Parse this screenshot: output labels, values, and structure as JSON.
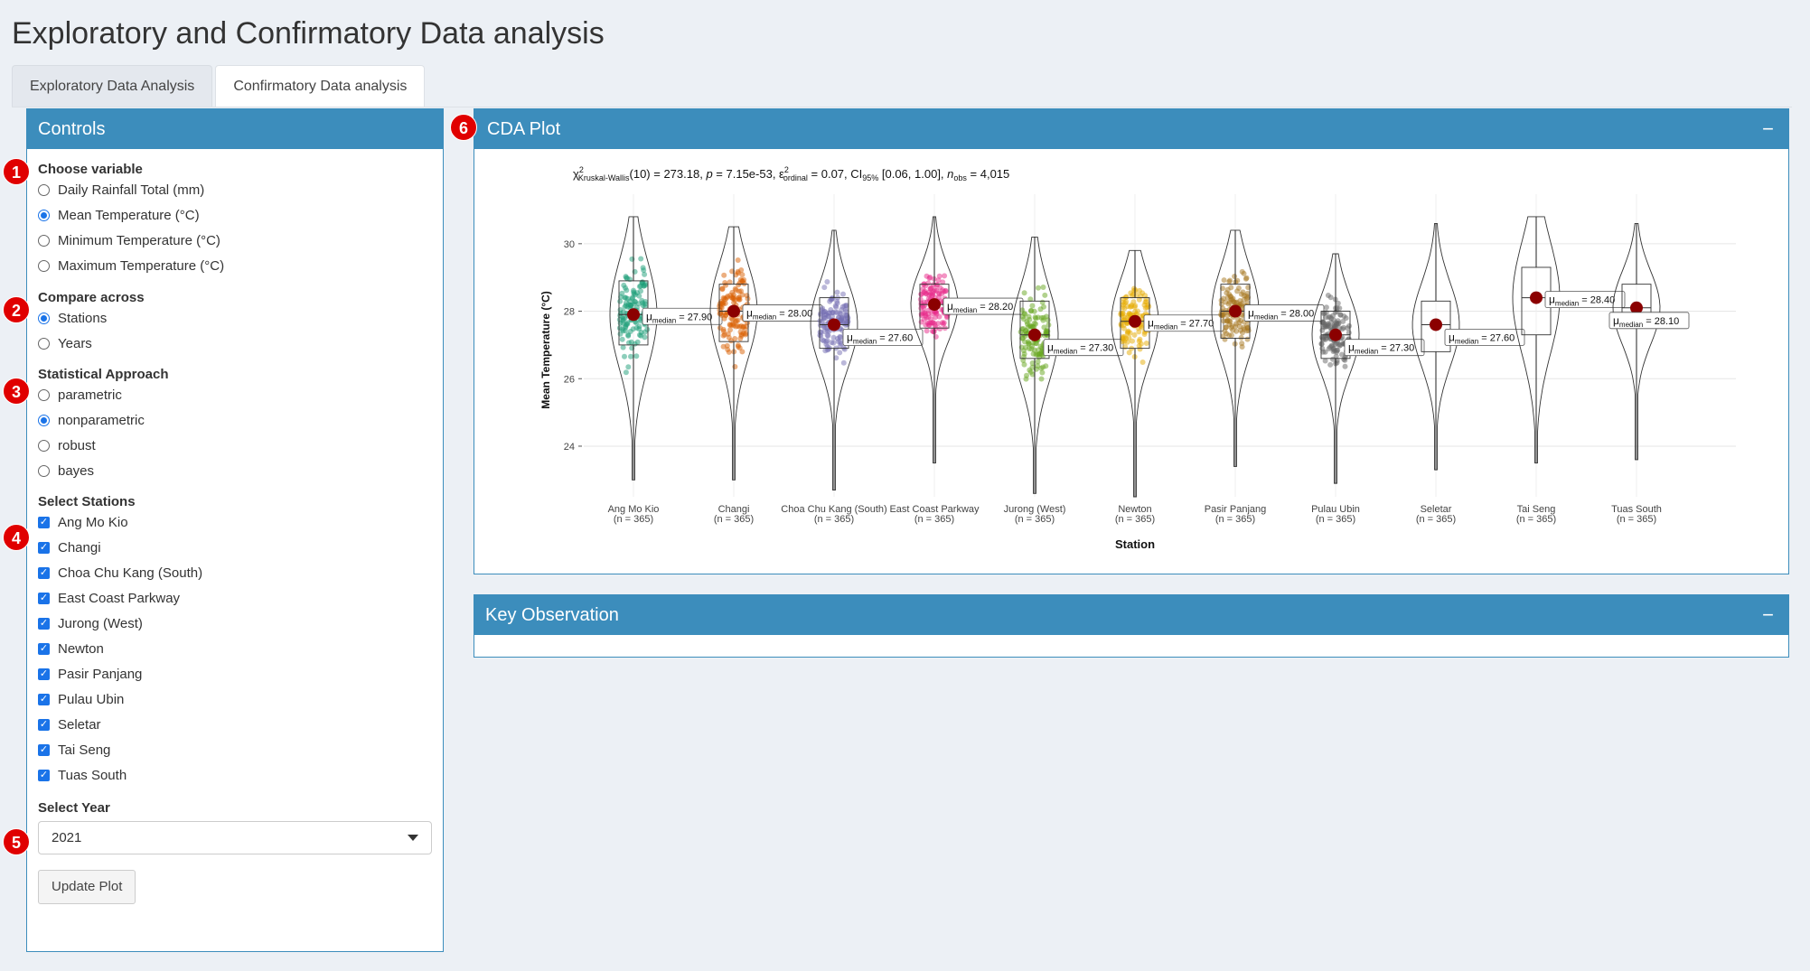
{
  "app": {
    "title": "Exploratory and Confirmatory Data analysis"
  },
  "tabs": [
    {
      "label": "Exploratory Data Analysis",
      "active": false
    },
    {
      "label": "Confirmatory Data analysis",
      "active": true
    }
  ],
  "controls": {
    "title": "Controls",
    "variable": {
      "label": "Choose variable",
      "options": [
        "Daily Rainfall Total (mm)",
        "Mean Temperature (°C)",
        "Minimum Temperature (°C)",
        "Maximum Temperature (°C)"
      ],
      "selected": "Mean Temperature (°C)"
    },
    "compare": {
      "label": "Compare across",
      "options": [
        "Stations",
        "Years"
      ],
      "selected": "Stations"
    },
    "approach": {
      "label": "Statistical Approach",
      "options": [
        "parametric",
        "nonparametric",
        "robust",
        "bayes"
      ],
      "selected": "nonparametric"
    },
    "stations": {
      "label": "Select Stations",
      "options": [
        "Ang Mo Kio",
        "Changi",
        "Choa Chu Kang (South)",
        "East Coast Parkway",
        "Jurong (West)",
        "Newton",
        "Pasir Panjang",
        "Pulau Ubin",
        "Seletar",
        "Tai Seng",
        "Tuas South"
      ],
      "checked": [
        true,
        true,
        true,
        true,
        true,
        true,
        true,
        true,
        true,
        true,
        true
      ]
    },
    "year": {
      "label": "Select Year",
      "value": "2021"
    },
    "update_button": "Update Plot"
  },
  "badges": [
    "1",
    "2",
    "3",
    "4",
    "5",
    "6"
  ],
  "cda_box": {
    "title": "CDA Plot",
    "collapse": "−"
  },
  "key_box": {
    "title": "Key Observation",
    "collapse": "−"
  },
  "chart_data": {
    "type": "violin-box",
    "subtitle": {
      "stat_symbol": "χ",
      "stat_sup": "2",
      "stat_sub": "Kruskal-Wallis",
      "stat_value": "(10) = 273.18,",
      "p_label": "p",
      "p_value": "= 7.15e-53,",
      "effect_symbol": "ε",
      "effect_sup": "2",
      "effect_sub": "ordinal",
      "effect_value": "= 0.07, CI",
      "ci_sub": "95%",
      "ci_value": "[0.06, 1.00],",
      "n_label": "n",
      "n_sub": "obs",
      "n_value": "= 4,015"
    },
    "xlabel": "Station",
    "ylabel": "Mean Temperature (°C)",
    "ylim": [
      22.5,
      31.2
    ],
    "yticks": [
      24,
      26,
      28,
      30
    ],
    "median_prefix": "μ",
    "median_sub": "median",
    "categories": [
      "Ang Mo Kio",
      "Changi",
      "Choa Chu Kang (South)",
      "East Coast Parkway",
      "Jurong (West)",
      "Newton",
      "Pasir Panjang",
      "Pulau Ubin",
      "Seletar",
      "Tai Seng",
      "Tuas South"
    ],
    "n_labels": [
      "(n = 365)",
      "(n = 365)",
      "(n = 365)",
      "(n = 365)",
      "(n = 365)",
      "(n = 365)",
      "(n = 365)",
      "(n = 365)",
      "(n = 365)",
      "(n = 365)",
      "(n = 365)"
    ],
    "medians": [
      27.9,
      28.0,
      27.6,
      28.2,
      27.3,
      27.7,
      28.0,
      27.3,
      27.6,
      28.4,
      28.1
    ],
    "median_labels": [
      "= 27.90",
      "= 28.00",
      "= 27.60",
      "= 28.20",
      "= 27.30",
      "= 27.70",
      "= 28.00",
      "= 27.30",
      "= 27.60",
      "= 28.40",
      "= 28.10"
    ],
    "q1": [
      27.0,
      27.1,
      26.9,
      27.5,
      26.6,
      26.9,
      27.2,
      26.6,
      26.8,
      27.3,
      27.5
    ],
    "q3": [
      28.9,
      28.8,
      28.4,
      28.8,
      28.3,
      28.4,
      28.8,
      28.0,
      28.3,
      29.3,
      28.8
    ],
    "min": [
      23.0,
      23.0,
      22.7,
      23.5,
      22.6,
      22.5,
      23.4,
      22.9,
      23.3,
      23.5,
      23.6
    ],
    "max": [
      30.8,
      30.5,
      30.4,
      30.8,
      30.2,
      29.8,
      30.4,
      29.7,
      30.6,
      30.8,
      30.6
    ],
    "colors": [
      "#1b9e77",
      "#d95f02",
      "#7570b3",
      "#e7298a",
      "#66a61e",
      "#e6ab02",
      "#a6761d",
      "#666666",
      "#e41a1c",
      "#377eb8",
      "#4daf4a"
    ],
    "has_points": [
      true,
      true,
      true,
      true,
      true,
      true,
      true,
      true,
      false,
      false,
      false
    ],
    "median_point_color": "#8b0000",
    "grid": true
  }
}
